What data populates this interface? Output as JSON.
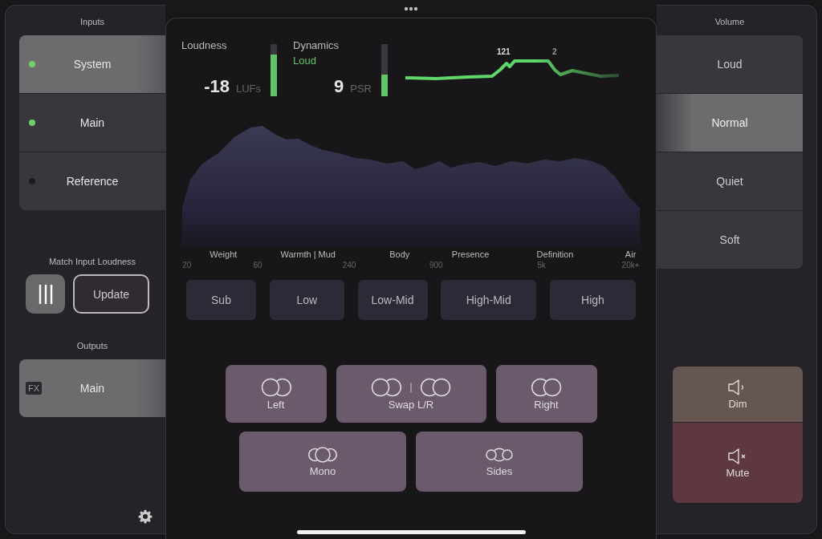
{
  "inputs": {
    "title": "Inputs",
    "items": [
      {
        "label": "System",
        "selected": true,
        "active": true
      },
      {
        "label": "Main",
        "selected": false,
        "active": true
      },
      {
        "label": "Reference",
        "selected": false,
        "active": false
      }
    ]
  },
  "match": {
    "title": "Match Input Loudness",
    "button": "Update"
  },
  "outputs": {
    "title": "Outputs",
    "items": [
      {
        "badge": "FX",
        "label": "Main",
        "selected": true
      }
    ]
  },
  "loudness": {
    "title": "Loudness",
    "value": "-18",
    "unit": "LUFs",
    "level": 0.8
  },
  "dynamics": {
    "title": "Dynamics",
    "status": "Loud",
    "value": "9",
    "unit": "PSR",
    "level": 0.42
  },
  "history": {
    "markers": [
      "121",
      "2"
    ]
  },
  "regions": [
    "Weight",
    "Warmth | Mud",
    "Body",
    "Presence",
    "Definition",
    "Air"
  ],
  "frequencies": [
    "20",
    "60",
    "240",
    "900",
    "5k",
    "20k+"
  ],
  "bands": [
    {
      "label": "Sub",
      "selected": false
    },
    {
      "label": "Low",
      "selected": false
    },
    {
      "label": "Low-Mid",
      "selected": false
    },
    {
      "label": "High-Mid",
      "selected": false
    },
    {
      "label": "High",
      "selected": false
    }
  ],
  "stereo": [
    {
      "label": "Left"
    },
    {
      "label": "Swap L/R"
    },
    {
      "label": "Right"
    },
    {
      "label": "Mono"
    },
    {
      "label": "Sides"
    }
  ],
  "volume": {
    "title": "Volume",
    "items": [
      {
        "label": "Loud",
        "selected": false
      },
      {
        "label": "Normal",
        "selected": true
      },
      {
        "label": "Quiet",
        "selected": false
      },
      {
        "label": "Soft",
        "selected": false
      }
    ]
  },
  "monitor": [
    {
      "kind": "dim",
      "label": "Dim"
    },
    {
      "kind": "mute",
      "label": "Mute"
    }
  ]
}
